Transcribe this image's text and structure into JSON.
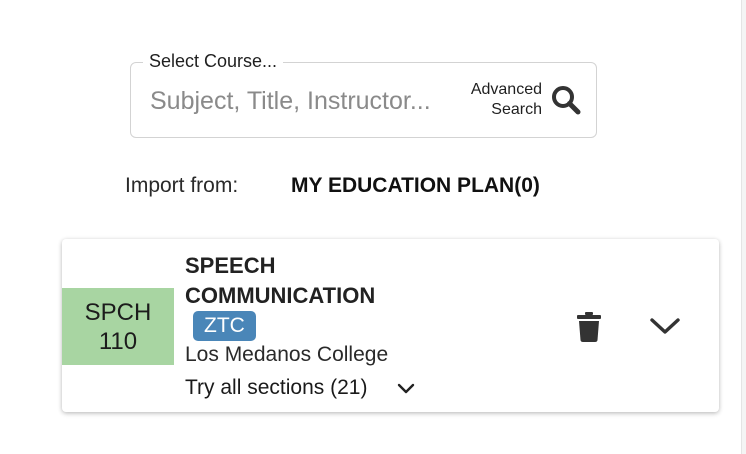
{
  "course_search": {
    "legend": "Select Course...",
    "placeholder": "Subject, Title, Instructor...",
    "advanced_search_label": "Advanced Search",
    "search_icon": "search-icon"
  },
  "import": {
    "label": "Import from:",
    "plan_label": "MY EDUCATION PLAN(0)"
  },
  "course_card": {
    "code_subject": "SPCH",
    "code_number": "110",
    "title": "SPEECH COMMUNICATION",
    "badge": "ZTC",
    "college": "Los Medanos College",
    "sections_label": "Try all sections (21)",
    "icons": [
      "chevron-down-icon",
      "trash-icon",
      "chevron-down-icon"
    ]
  },
  "colors": {
    "code_bg": "#a8d5a2",
    "badge_bg": "#4a86b8",
    "icon": "#333333"
  }
}
